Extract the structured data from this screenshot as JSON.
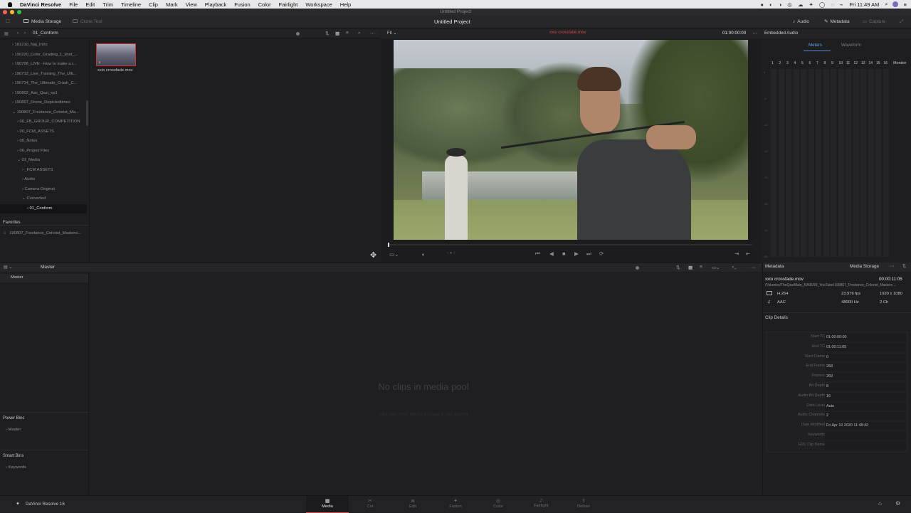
{
  "menubar": {
    "apple": "",
    "app": "DaVinci Resolve",
    "items": [
      "File",
      "Edit",
      "Trim",
      "Timeline",
      "Clip",
      "Mark",
      "View",
      "Playback",
      "Fusion",
      "Color",
      "Fairlight",
      "Workspace",
      "Help"
    ],
    "clock": "Fri 11:49 AM"
  },
  "window": {
    "title": "Untitled Project"
  },
  "toolbar": {
    "media_storage": "Media Storage",
    "clone_tool": "Clone Tool",
    "project_title": "Untitled Project",
    "audio": "Audio",
    "metadata": "Metadata",
    "capture": "Capture"
  },
  "storage": {
    "current_folder": "01_Conform",
    "tree": [
      {
        "label": "181210_Naj_Intro",
        "indent": 0,
        "open": false
      },
      {
        "label": "190220_Color_Grading_1_shot_...",
        "indent": 0,
        "open": false
      },
      {
        "label": "190706_LIVE - How to make a r...",
        "indent": 0,
        "open": false
      },
      {
        "label": "190712_Live_Training_The_Ulti...",
        "indent": 0,
        "open": false
      },
      {
        "label": "190714_The_Ultimate_Crash_C...",
        "indent": 0,
        "open": false
      },
      {
        "label": "190802_Ask_Qazi_ep1",
        "indent": 0,
        "open": false
      },
      {
        "label": "190807_Drone_Depictedtimes",
        "indent": 0,
        "open": false
      },
      {
        "label": "190807_Freelance_Colorist_Ma...",
        "indent": 0,
        "open": true
      },
      {
        "label": "00_FB_GROUP_COMPETITION",
        "indent": 1,
        "open": false
      },
      {
        "label": "00_FCM_ASSETS",
        "indent": 1,
        "open": false
      },
      {
        "label": "00_Notes",
        "indent": 1,
        "open": false
      },
      {
        "label": "00_Project Files",
        "indent": 1,
        "open": false
      },
      {
        "label": "01_Media",
        "indent": 1,
        "open": true
      },
      {
        "label": "_FCM ASSETS",
        "indent": 2,
        "open": false
      },
      {
        "label": "Audio",
        "indent": 2,
        "open": false
      },
      {
        "label": "Camera Original",
        "indent": 2,
        "open": false
      },
      {
        "label": "Converted",
        "indent": 2,
        "open": true
      },
      {
        "label": "01_Conform",
        "indent": 3,
        "open": false
      }
    ],
    "favorites_title": "Favorites",
    "favorites": [
      "190807_Freelance_Colorist_Masterci..."
    ]
  },
  "clip": {
    "name": "xxio crossfade.mov"
  },
  "viewer": {
    "fit": "Fit",
    "clip_name": "xxio crossfade.mov",
    "timecode": "01:00:00:00"
  },
  "audio_panel": {
    "title": "Embedded Audio",
    "tab_meters": "Meters",
    "tab_waveform": "Waveform",
    "channels": [
      "1",
      "2",
      "3",
      "4",
      "5",
      "6",
      "7",
      "8",
      "9",
      "10",
      "11",
      "12",
      "13",
      "14",
      "15",
      "16"
    ],
    "monitor": "Monitor",
    "scale": [
      "0",
      "-5",
      "-10",
      "-15",
      "-20",
      "-30",
      "-40",
      "-50"
    ]
  },
  "pool": {
    "bin": "Master",
    "master_item": "Master",
    "empty_title": "No clips in media pool",
    "empty_hint": "Add clips from Media Storage to get started",
    "power_bins": "Power Bins",
    "power_item": "Master",
    "smart_bins": "Smart Bins",
    "smart_item": "Keywords"
  },
  "metadata": {
    "title": "Metadata",
    "source": "Media Storage",
    "clip_name": "xxio crossfade.mov",
    "duration": "00:00:11:05",
    "path": "/Volumes/TheQaziMain_RAID/99_YouTube/190807_Freelance_Colorist_Masterc...",
    "codec": "H.264",
    "fps": "23.976 fps",
    "resolution": "1920 x 1080",
    "audio_codec": "AAC",
    "sample_rate": "48000 Hz",
    "channels": "2 Ch",
    "details_title": "Clip Details",
    "details": [
      [
        "Start TC",
        "01:00:00:00"
      ],
      [
        "End TC",
        "01:00:11:05"
      ],
      [
        "Start Frame",
        "0"
      ],
      [
        "End Frame",
        "268"
      ],
      [
        "Frames",
        "269"
      ],
      [
        "Bit Depth",
        "8"
      ],
      [
        "Audio Bit Depth",
        "16"
      ],
      [
        "Data Level",
        "Auto"
      ],
      [
        "Audio Channels",
        "2"
      ],
      [
        "Date Modified",
        "Fri Apr 10 2020 11:48:42"
      ],
      [
        "Keywords",
        ""
      ],
      [
        "EDL Clip Name",
        ""
      ]
    ]
  },
  "pages": {
    "brand": "DaVinci Resolve 16",
    "items": [
      "Media",
      "Cut",
      "Edit",
      "Fusion",
      "Color",
      "Fairlight",
      "Deliver"
    ],
    "active": "Media"
  }
}
